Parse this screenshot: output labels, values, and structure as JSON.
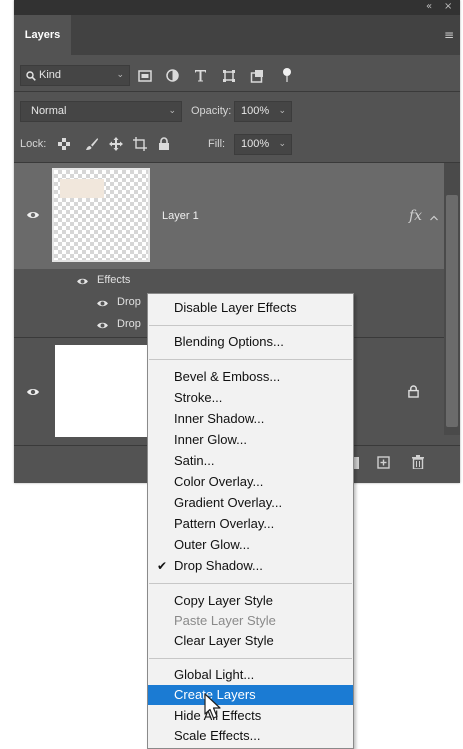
{
  "panel": {
    "tab_label": "Layers",
    "collapse_glyph": "«",
    "close_glyph": "×",
    "panel_menu_glyph": "≡"
  },
  "filter": {
    "kind_label": "Kind",
    "icons": [
      "image-filter-icon",
      "adjustment-filter-icon",
      "type-filter-icon",
      "shape-filter-icon",
      "smart-object-filter-icon",
      "toggle-filter-icon"
    ]
  },
  "blend": {
    "mode": "Normal",
    "opacity_label": "Opacity:",
    "opacity_value": "100%"
  },
  "lock": {
    "label": "Lock:",
    "fill_label": "Fill:",
    "fill_value": "100%"
  },
  "layers": [
    {
      "name": "Layer 1",
      "fx_label": "fx",
      "effects_label": "Effects",
      "effects": [
        "Drop",
        "Drop"
      ]
    },
    {
      "name": "",
      "locked": true
    }
  ],
  "context_menu": {
    "groups": [
      [
        {
          "label": "Disable Layer Effects"
        }
      ],
      [
        {
          "label": "Blending Options..."
        }
      ],
      [
        {
          "label": "Bevel & Emboss..."
        },
        {
          "label": "Stroke..."
        },
        {
          "label": "Inner Shadow..."
        },
        {
          "label": "Inner Glow..."
        },
        {
          "label": "Satin..."
        },
        {
          "label": "Color Overlay..."
        },
        {
          "label": "Gradient Overlay..."
        },
        {
          "label": "Pattern Overlay..."
        },
        {
          "label": "Outer Glow..."
        },
        {
          "label": "Drop Shadow...",
          "checked": true
        }
      ],
      [
        {
          "label": "Copy Layer Style"
        },
        {
          "label": "Paste Layer Style",
          "disabled": true
        },
        {
          "label": "Clear Layer Style"
        }
      ],
      [
        {
          "label": "Global Light..."
        },
        {
          "label": "Create Layers",
          "highlighted": true
        },
        {
          "label": "Hide All Effects"
        },
        {
          "label": "Scale Effects..."
        }
      ]
    ],
    "check_glyph": "✔"
  },
  "colors": {
    "panel_bg": "#535353",
    "selected_layer_bg": "#6a6a6a",
    "menu_bg": "#f2f2f2",
    "menu_highlight": "#1b7bd3"
  }
}
